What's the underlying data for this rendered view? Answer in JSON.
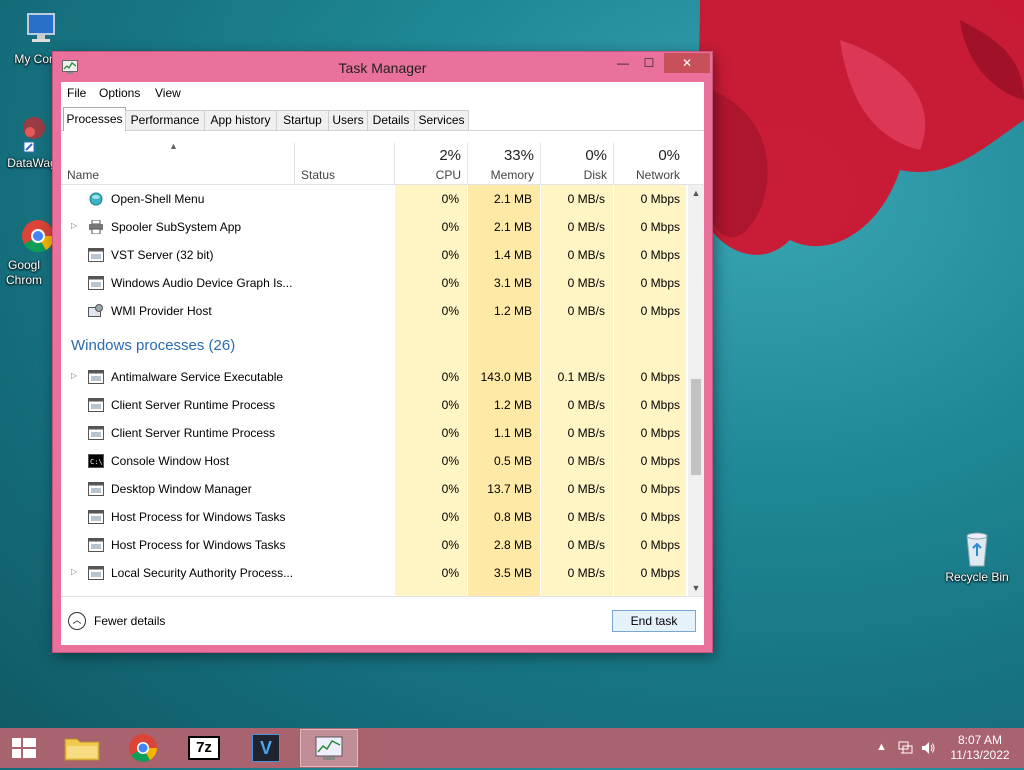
{
  "desktop": {
    "icons": [
      {
        "label": "My Comp"
      },
      {
        "label": "DataWag"
      },
      {
        "label": "Googl Chrom"
      },
      {
        "label": "Recycle Bin"
      }
    ]
  },
  "window": {
    "title": "Task Manager",
    "controls": {
      "minimize": "—",
      "maximize": "☐",
      "close": "✕"
    }
  },
  "menu": {
    "file": "File",
    "options": "Options",
    "view": "View"
  },
  "tabs": [
    {
      "label": "Processes",
      "active": true
    },
    {
      "label": "Performance"
    },
    {
      "label": "App history"
    },
    {
      "label": "Startup"
    },
    {
      "label": "Users"
    },
    {
      "label": "Details"
    },
    {
      "label": "Services"
    }
  ],
  "columns": {
    "name": "Name",
    "status": "Status",
    "cpu": {
      "pct": "2%",
      "label": "CPU"
    },
    "memory": {
      "pct": "33%",
      "label": "Memory"
    },
    "disk": {
      "pct": "0%",
      "label": "Disk"
    },
    "network": {
      "pct": "0%",
      "label": "Network"
    }
  },
  "processes_top": [
    {
      "name": "Open-Shell Menu",
      "cpu": "0%",
      "memory": "2.1 MB",
      "disk": "0 MB/s",
      "network": "0 Mbps",
      "expand": false,
      "icon": "shell-icon"
    },
    {
      "name": "Spooler SubSystem App",
      "cpu": "0%",
      "memory": "2.1 MB",
      "disk": "0 MB/s",
      "network": "0 Mbps",
      "expand": true,
      "icon": "printer-icon"
    },
    {
      "name": "VST Server (32 bit)",
      "cpu": "0%",
      "memory": "1.4 MB",
      "disk": "0 MB/s",
      "network": "0 Mbps",
      "expand": false,
      "icon": "app-window-icon"
    },
    {
      "name": "Windows Audio Device Graph Is...",
      "cpu": "0%",
      "memory": "3.1 MB",
      "disk": "0 MB/s",
      "network": "0 Mbps",
      "expand": false,
      "icon": "app-window-icon"
    },
    {
      "name": "WMI Provider Host",
      "cpu": "0%",
      "memory": "1.2 MB",
      "disk": "0 MB/s",
      "network": "0 Mbps",
      "expand": false,
      "icon": "wmi-icon"
    }
  ],
  "group": {
    "title": "Windows processes (26)"
  },
  "processes_windows": [
    {
      "name": "Antimalware Service Executable",
      "cpu": "0%",
      "memory": "143.0 MB",
      "disk": "0.1 MB/s",
      "network": "0 Mbps",
      "expand": true,
      "icon": "app-window-icon"
    },
    {
      "name": "Client Server Runtime Process",
      "cpu": "0%",
      "memory": "1.2 MB",
      "disk": "0 MB/s",
      "network": "0 Mbps",
      "expand": false,
      "icon": "app-window-icon"
    },
    {
      "name": "Client Server Runtime Process",
      "cpu": "0%",
      "memory": "1.1 MB",
      "disk": "0 MB/s",
      "network": "0 Mbps",
      "expand": false,
      "icon": "app-window-icon"
    },
    {
      "name": "Console Window Host",
      "cpu": "0%",
      "memory": "0.5 MB",
      "disk": "0 MB/s",
      "network": "0 Mbps",
      "expand": false,
      "icon": "console-icon"
    },
    {
      "name": "Desktop Window Manager",
      "cpu": "0%",
      "memory": "13.7 MB",
      "disk": "0 MB/s",
      "network": "0 Mbps",
      "expand": false,
      "icon": "app-window-icon"
    },
    {
      "name": "Host Process for Windows Tasks",
      "cpu": "0%",
      "memory": "0.8 MB",
      "disk": "0 MB/s",
      "network": "0 Mbps",
      "expand": false,
      "icon": "app-window-icon"
    },
    {
      "name": "Host Process for Windows Tasks",
      "cpu": "0%",
      "memory": "2.8 MB",
      "disk": "0 MB/s",
      "network": "0 Mbps",
      "expand": false,
      "icon": "app-window-icon"
    },
    {
      "name": "Local Security Authority Process...",
      "cpu": "0%",
      "memory": "3.5 MB",
      "disk": "0 MB/s",
      "network": "0 Mbps",
      "expand": true,
      "icon": "app-window-icon"
    }
  ],
  "footer": {
    "fewer_details": "Fewer details",
    "end_task": "End task"
  },
  "taskbar": {
    "items": [
      {
        "name": "start-button"
      },
      {
        "name": "file-explorer"
      },
      {
        "name": "chrome"
      },
      {
        "name": "7zip",
        "label": "7z"
      },
      {
        "name": "veracrypt",
        "label": "V"
      },
      {
        "name": "task-manager",
        "active": true
      }
    ],
    "time": "8:07 AM",
    "date": "11/13/2022"
  },
  "colors": {
    "window_frame": "#e9719b",
    "cpu_col": "#fff4c4",
    "memory_col": "#ffe9a6",
    "disk_col": "#fff4c4",
    "network_col": "#fff4c4",
    "group_title": "#2a6bb0"
  }
}
